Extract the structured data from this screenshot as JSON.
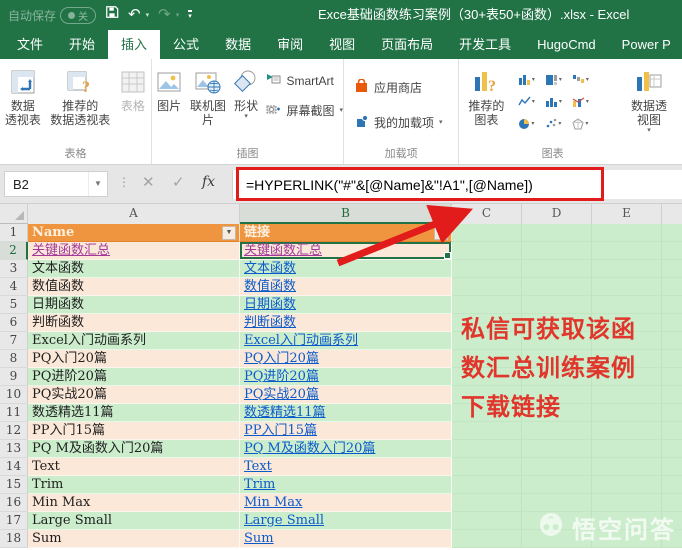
{
  "window": {
    "title": "Exce基础函数练习案例（30+表50+函数）.xlsx  -  Excel"
  },
  "quick_access": {
    "autosave_label": "自动保存",
    "autosave_state": "关",
    "undo_glyph": "↶",
    "redo_glyph": "↷"
  },
  "tabs": [
    {
      "id": "file",
      "label": "文件"
    },
    {
      "id": "home",
      "label": "开始"
    },
    {
      "id": "insert",
      "label": "插入",
      "active": true
    },
    {
      "id": "formulas",
      "label": "公式"
    },
    {
      "id": "data",
      "label": "数据"
    },
    {
      "id": "review",
      "label": "审阅"
    },
    {
      "id": "view",
      "label": "视图"
    },
    {
      "id": "page-layout",
      "label": "页面布局"
    },
    {
      "id": "developer",
      "label": "开发工具"
    },
    {
      "id": "hugocmd",
      "label": "HugoCmd"
    },
    {
      "id": "power-pivot",
      "label": "Power P"
    }
  ],
  "ribbon": {
    "groups": [
      {
        "label": "表格",
        "buttons": [
          {
            "label": "数据透视表",
            "lines": [
              "数据",
              "透视表"
            ]
          },
          {
            "label": "推荐的数据透视表",
            "lines": [
              "推荐的",
              "数据透视表"
            ]
          },
          {
            "label": "表格",
            "lines": [
              "表格"
            ],
            "disabled": true
          }
        ]
      },
      {
        "label": "插图",
        "buttons": [
          {
            "label": "图片",
            "lines": [
              "图片"
            ]
          },
          {
            "label": "联机图片",
            "lines": [
              "联机图片"
            ]
          },
          {
            "label": "形状",
            "lines": [
              "形状"
            ],
            "dropdown": true
          },
          {
            "label": "SmartArt"
          },
          {
            "label": "屏幕截图",
            "dropdown": true
          }
        ]
      },
      {
        "label": "加载项",
        "buttons": [
          {
            "label": "应用商店"
          },
          {
            "label": "我的加载项",
            "dropdown": true
          }
        ]
      },
      {
        "label": "图表",
        "buttons": [
          {
            "label": "推荐的图表",
            "lines": [
              "推荐的",
              "图表"
            ]
          },
          {
            "label": "数据透视图",
            "lines": [
              "数据透",
              "视图"
            ]
          }
        ],
        "mini_buttons": [
          "column-chart",
          "hierarchy-chart",
          "waterfall-chart",
          "line-chart",
          "histogram-chart",
          "combo-chart",
          "pie-chart",
          "scatter-chart",
          "radar-chart"
        ]
      }
    ]
  },
  "formula_bar": {
    "name_box": "B2",
    "cancel_glyph": "✕",
    "enter_glyph": "✓",
    "fx_label": "fx",
    "formula": "=HYPERLINK(\"#\"&[@Name]&\"!A1\",[@Name])"
  },
  "sheet": {
    "col_headers": [
      "A",
      "B",
      "C",
      "D",
      "E"
    ],
    "active_cell": "B2",
    "table_header": {
      "name": "Name",
      "link": "链接"
    },
    "rows": [
      {
        "n": 2,
        "a": "关键函数汇总",
        "b": "关键函数汇总",
        "a_style": "visited",
        "b_style": "visited",
        "active": true
      },
      {
        "n": 3,
        "a": "文本函数",
        "b": "文本函数"
      },
      {
        "n": 4,
        "a": "数值函数",
        "b": "数值函数"
      },
      {
        "n": 5,
        "a": "日期函数",
        "b": "日期函数"
      },
      {
        "n": 6,
        "a": "判断函数",
        "b": "判断函数"
      },
      {
        "n": 7,
        "a": "Excel入门动画系列",
        "b": "Excel入门动画系列"
      },
      {
        "n": 8,
        "a": "PQ入门20篇",
        "b": "PQ入门20篇"
      },
      {
        "n": 9,
        "a": "PQ进阶20篇",
        "b": "PQ进阶20篇"
      },
      {
        "n": 10,
        "a": "PQ实战20篇",
        "b": "PQ实战20篇"
      },
      {
        "n": 11,
        "a": "数透精选11篇",
        "b": "数透精选11篇"
      },
      {
        "n": 12,
        "a": "PP入门15篇",
        "b": "PP入门15篇"
      },
      {
        "n": 13,
        "a": "PQ M及函数入门20篇",
        "b": "PQ M及函数入门20篇"
      },
      {
        "n": 14,
        "a": "Text",
        "b": "Text"
      },
      {
        "n": 15,
        "a": "Trim",
        "b": "Trim"
      },
      {
        "n": 16,
        "a": "Min Max",
        "b": "Min Max"
      },
      {
        "n": 17,
        "a": "Large Small",
        "b": "Large Small"
      },
      {
        "n": 18,
        "a": "Sum",
        "b": "Sum"
      }
    ]
  },
  "annotation": {
    "lines": [
      "私信可获取该函",
      "数汇总训练案例",
      "下载链接"
    ],
    "color": "#E0362C"
  },
  "watermark": {
    "text": "悟空问答"
  },
  "colors": {
    "titlebar_green": "#217346",
    "header_orange": "#F0953F",
    "band_green": "#CBEDCC",
    "band_peach": "#FCE8D8",
    "link_blue": "#0B5BCB",
    "link_visited": "#A33A9B",
    "highlight_red": "#E21B1B"
  }
}
